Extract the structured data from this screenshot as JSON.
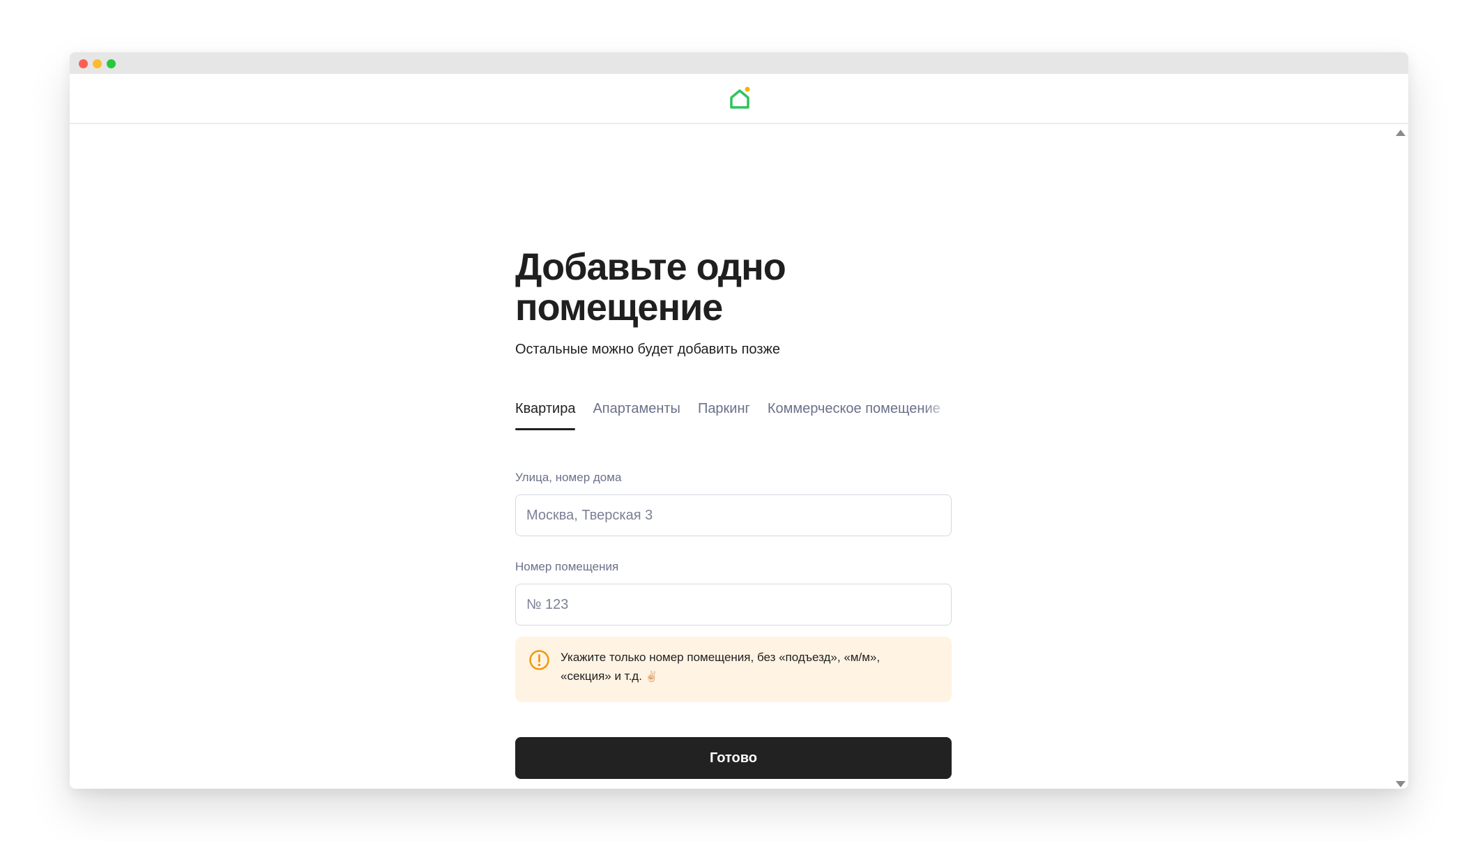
{
  "logo": {
    "icon": "house-icon",
    "accent_color": "#2ec45c",
    "dot_color": "#f5b400"
  },
  "page": {
    "title": "Добавьте одно помещение",
    "subtitle": "Остальные можно будет добавить позже"
  },
  "tabs": [
    {
      "label": "Квартира",
      "active": true
    },
    {
      "label": "Апартаменты",
      "active": false
    },
    {
      "label": "Паркинг",
      "active": false
    },
    {
      "label": "Коммерческое помещение",
      "active": false
    }
  ],
  "form": {
    "street": {
      "label": "Улица, номер дома",
      "placeholder": "Москва, Тверская 3",
      "value": ""
    },
    "unit": {
      "label": "Номер помещения",
      "placeholder": "№ 123",
      "value": ""
    }
  },
  "notice": {
    "icon": "warning-circle-icon",
    "text": "Укажите только номер помещения, без «подъезд», «м/м», «секция» и т.д.",
    "emoji": "✌🏻",
    "color": "#f09a0c"
  },
  "submit_label": "Готово"
}
